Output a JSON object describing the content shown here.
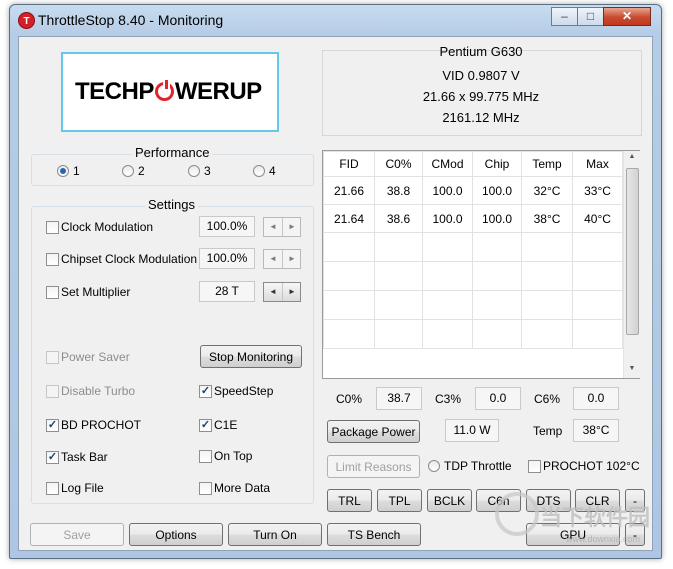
{
  "window": {
    "title": "ThrottleStop 8.40 - Monitoring",
    "icon_letter": "T"
  },
  "caption": {
    "min": "–",
    "max": "□",
    "close": "✕"
  },
  "logo": {
    "part1": "TECHP",
    "part3": "WERUP"
  },
  "cpu": {
    "name": "Pentium G630",
    "vid": "VID  0.9807 V",
    "multiplier": "21.66 x 99.775 MHz",
    "freq": "2161.12 MHz"
  },
  "performance": {
    "title": "Performance",
    "options": [
      "1",
      "2",
      "3",
      "4"
    ],
    "selected": 0
  },
  "settings": {
    "title": "Settings",
    "clock_modulation": {
      "label": "Clock Modulation",
      "value": "100.0%"
    },
    "chipset_clock_modulation": {
      "label": "Chipset Clock Modulation",
      "value": "100.0%"
    },
    "set_multiplier": {
      "label": "Set Multiplier",
      "value": "28 T"
    },
    "power_saver": "Power Saver",
    "stop_monitoring": "Stop Monitoring",
    "disable_turbo": "Disable Turbo",
    "speedstep": "SpeedStep",
    "bd_prochot": "BD PROCHOT",
    "c1e": "C1E",
    "task_bar": "Task Bar",
    "on_top": "On Top",
    "log_file": "Log File",
    "more_data": "More Data",
    "spin_left": "◄",
    "spin_right": "►"
  },
  "table": {
    "headers": [
      "FID",
      "C0%",
      "CMod",
      "Chip",
      "Temp",
      "Max"
    ],
    "rows": [
      [
        "21.66",
        "38.8",
        "100.0",
        "100.0",
        "32°C",
        "33°C"
      ],
      [
        "21.64",
        "38.6",
        "100.0",
        "100.0",
        "38°C",
        "40°C"
      ]
    ],
    "scroll_up": "▲",
    "scroll_down": "▼"
  },
  "cstates": {
    "c0_label": "C0%",
    "c0_value": "38.7",
    "c3_label": "C3%",
    "c3_value": "0.0",
    "c6_label": "C6%",
    "c6_value": "0.0"
  },
  "package": {
    "button": "Package Power",
    "value": "11.0 W",
    "temp_label": "Temp",
    "temp_value": "38°C"
  },
  "limits": {
    "button": "Limit Reasons",
    "tdp": "TDP Throttle",
    "prochot": "PROCHOT 102°C"
  },
  "tools": [
    "TRL",
    "TPL",
    "BCLK",
    "C6n",
    "DTS",
    "CLR"
  ],
  "tools_extra": "-",
  "bottom": {
    "save": "Save",
    "options": "Options",
    "turn_on": "Turn On",
    "ts_bench": "TS Bench",
    "gpu": "GPU",
    "dash": "-"
  },
  "watermark": {
    "text": "当下软件园",
    "url": "www.downxia.com"
  },
  "colors": {
    "accent": "#2b63b6",
    "logo_red": "#e0242b",
    "logo_border": "#66c8e8"
  }
}
